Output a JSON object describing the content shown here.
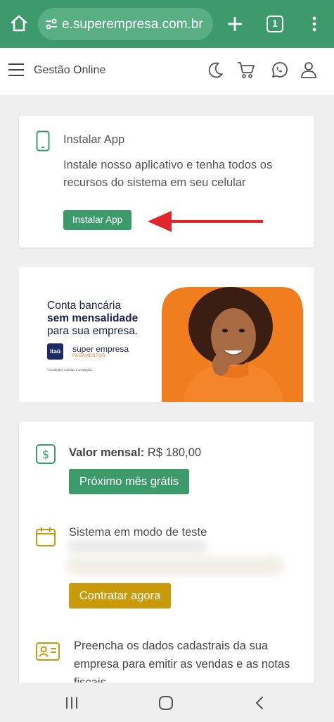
{
  "browser": {
    "url": "e.superempresa.com.br",
    "tab_count": "1",
    "icons": [
      "home-icon",
      "tune-icon",
      "plus-icon",
      "tab-switcher-icon",
      "more-vert-icon"
    ]
  },
  "header": {
    "title": "Gestão Online",
    "icons": [
      "menu-icon",
      "moon-icon",
      "cart-icon",
      "whatsapp-icon",
      "user-icon"
    ]
  },
  "install_card": {
    "title": "Instalar App",
    "description": "Instale nosso aplicativo e tenha todos os recursos do sistema em seu celular",
    "button_label": "Instalar App"
  },
  "banner": {
    "line1": "Conta bancária",
    "line2": "sem mensalidade",
    "line3": "para sua empresa.",
    "bank_logo": "itaú",
    "brand_name": "super empresa",
    "brand_sub": "PAGAMENTOS",
    "fine_print": "*Condições sujeitas a avaliação"
  },
  "subscription": {
    "price_label": "Valor mensal:",
    "price_value": "R$ 180,00",
    "free_button": "Próximo mês grátis",
    "trial_label": "Sistema em modo de teste",
    "hire_button": "Contratar agora",
    "register_text": "Preencha os dados cadastrais da sua empresa para emitir as vendas e as notas fiscais"
  },
  "colors": {
    "primary_green": "#3d9a6b",
    "gold": "#c99a0a",
    "arrow_red": "#e0262b",
    "banner_orange": "#f07d1e"
  }
}
